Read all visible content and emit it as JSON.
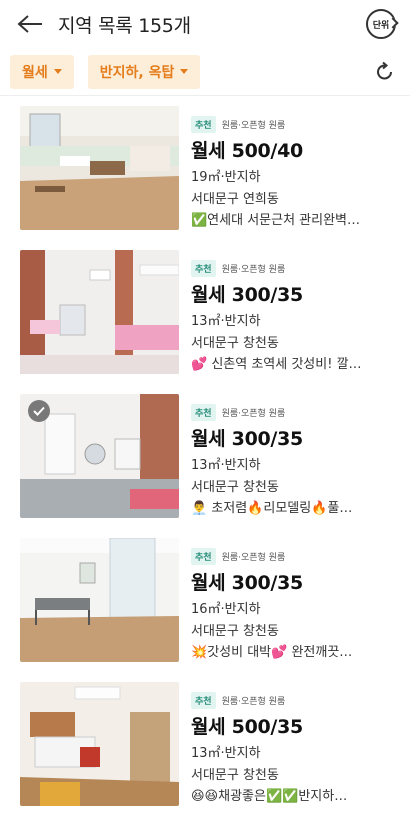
{
  "header": {
    "title": "지역 목록 155개",
    "unit_label": "단위"
  },
  "filters": [
    {
      "label": "월세"
    },
    {
      "label": "반지하, 옥탑"
    }
  ],
  "listings": [
    {
      "badge": "추천",
      "type": "원룸·오픈형 원룸",
      "price": "월세 500/40",
      "size": "19㎡·반지하",
      "location": "서대문구 연희동",
      "desc": "✅연세대 서문근처 관리완벽…"
    },
    {
      "badge": "추천",
      "type": "원룸·오픈형 원룸",
      "price": "월세 300/35",
      "size": "13㎡·반지하",
      "location": "서대문구 창천동",
      "desc": "💕 신촌역 초역세 갓성비! 깔…"
    },
    {
      "badge": "추천",
      "type": "원룸·오픈형 원룸",
      "price": "월세 300/35",
      "size": "13㎡·반지하",
      "location": "서대문구 창천동",
      "desc": "👨‍💼 초저렴🔥리모델링🔥풀…"
    },
    {
      "badge": "추천",
      "type": "원룸·오픈형 원룸",
      "price": "월세 300/35",
      "size": "16㎡·반지하",
      "location": "서대문구 창천동",
      "desc": "💥갓성비 대박💕 완전깨끗…"
    },
    {
      "badge": "추천",
      "type": "원룸·오픈형 원룸",
      "price": "월세 500/35",
      "size": "13㎡·반지하",
      "location": "서대문구 창천동",
      "desc": "😆😆채광좋은✅✅반지하…"
    }
  ],
  "colors": {
    "accent": "#e47d1c",
    "chip_bg": "#fdeed9",
    "badge_bg": "#e1f4f0",
    "badge_text": "#2a8e7c"
  },
  "icons": {
    "back": "arrow-left-icon",
    "unit": "unit-toggle-icon",
    "reset": "refresh-icon",
    "checked": "check-circle-icon"
  }
}
